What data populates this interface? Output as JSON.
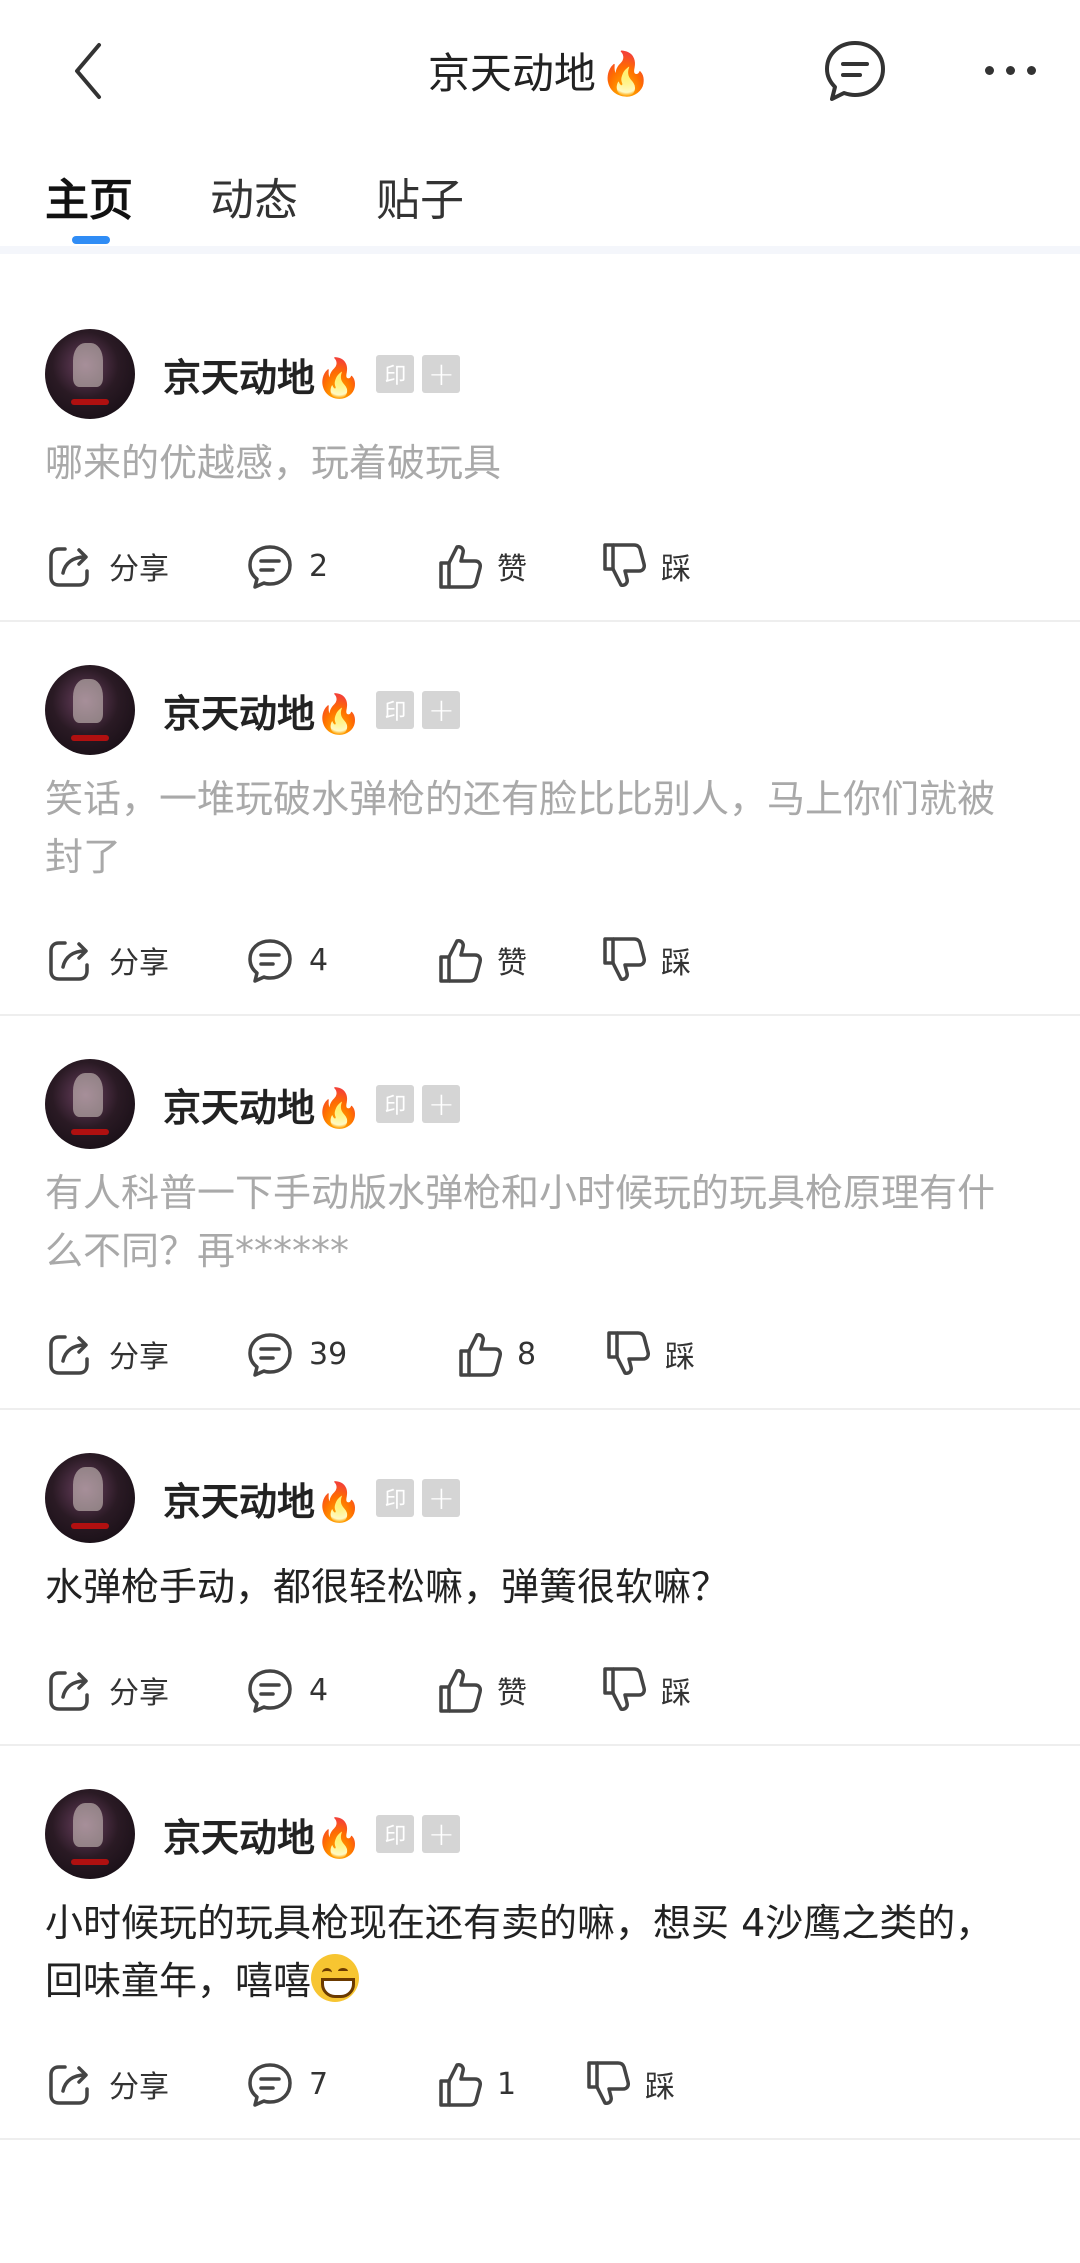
{
  "header": {
    "title": "京天动地",
    "title_emoji": "🔥"
  },
  "tabs": [
    {
      "label": "主页",
      "active": true
    },
    {
      "label": "动态",
      "active": false
    },
    {
      "label": "贴子",
      "active": false
    }
  ],
  "accent_color": "#2f8cf5",
  "posts": [
    {
      "username": "京天动地",
      "emoji": "🔥",
      "badge_1": "印",
      "badge_2": "+",
      "text": "哪来的优越感，玩着破玩具",
      "text_style": "grey",
      "share_label": "分享",
      "comment_count": "2",
      "like_label": "赞",
      "dislike_label": "踩"
    },
    {
      "username": "京天动地",
      "emoji": "🔥",
      "badge_1": "印",
      "badge_2": "+",
      "text": "笑话，一堆玩破水弹枪的还有脸比比别人，马上你们就被封了",
      "text_style": "grey",
      "share_label": "分享",
      "comment_count": "4",
      "like_label": "赞",
      "dislike_label": "踩"
    },
    {
      "username": "京天动地",
      "emoji": "🔥",
      "badge_1": "印",
      "badge_2": "+",
      "text": "有人科普一下手动版水弹枪和小时候玩的玩具枪原理有什么不同？再******",
      "text_style": "grey",
      "share_label": "分享",
      "comment_count": "39",
      "like_label": "8",
      "dislike_label": "踩"
    },
    {
      "username": "京天动地",
      "emoji": "🔥",
      "badge_1": "印",
      "badge_2": "+",
      "text": "水弹枪手动，都很轻松嘛，弹簧很软嘛？",
      "text_style": "dark",
      "share_label": "分享",
      "comment_count": "4",
      "like_label": "赞",
      "dislike_label": "踩"
    },
    {
      "username": "京天动地",
      "emoji": "🔥",
      "badge_1": "印",
      "badge_2": "+",
      "text": "小时候玩的玩具枪现在还有卖的嘛，想买 4沙鹰之类的，回味童年，嘻嘻",
      "text_style": "dark",
      "trailing_emoji": "grinning-face",
      "share_label": "分享",
      "comment_count": "7",
      "like_label": "1",
      "dislike_label": "踩"
    }
  ]
}
